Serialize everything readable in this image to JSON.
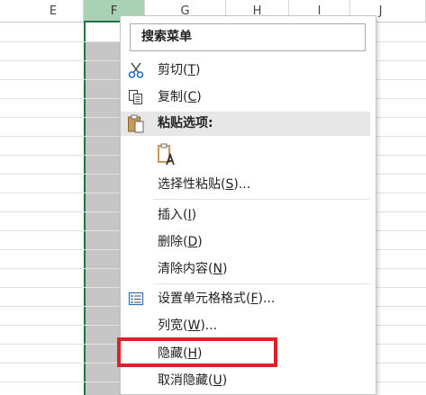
{
  "columns": [
    {
      "letter": "E"
    },
    {
      "letter": "F"
    },
    {
      "letter": "G"
    },
    {
      "letter": "H"
    },
    {
      "letter": "I"
    },
    {
      "letter": "J"
    }
  ],
  "menu": {
    "search_placeholder": "搜索菜单",
    "items": [
      {
        "text": "剪切(",
        "key": "T",
        "end": ")",
        "icon": "scissors-icon"
      },
      {
        "text": "复制(",
        "key": "C",
        "end": ")",
        "icon": "copy-icon"
      },
      {
        "header": "粘贴选项:",
        "icon": "paste-icon"
      },
      {
        "icon": "paste-text-only-icon"
      },
      {
        "text": "选择性粘贴(",
        "key": "S",
        "end": ")..."
      },
      {
        "text": "插入(",
        "key": "I",
        "end": ")"
      },
      {
        "text": "删除(",
        "key": "D",
        "end": ")"
      },
      {
        "text": "清除内容(",
        "key": "N",
        "end": ")"
      },
      {
        "text": "设置单元格格式(",
        "key": "F",
        "end": ")...",
        "icon": "format-cells-icon"
      },
      {
        "text": "列宽(",
        "key": "W",
        "end": ")..."
      },
      {
        "text": "隐藏(",
        "key": "H",
        "end": ")"
      },
      {
        "text": "取消隐藏(",
        "key": "U",
        "end": ")"
      }
    ]
  },
  "colors": {
    "selected_column": "#217346",
    "highlight_box": "#e0202a"
  }
}
